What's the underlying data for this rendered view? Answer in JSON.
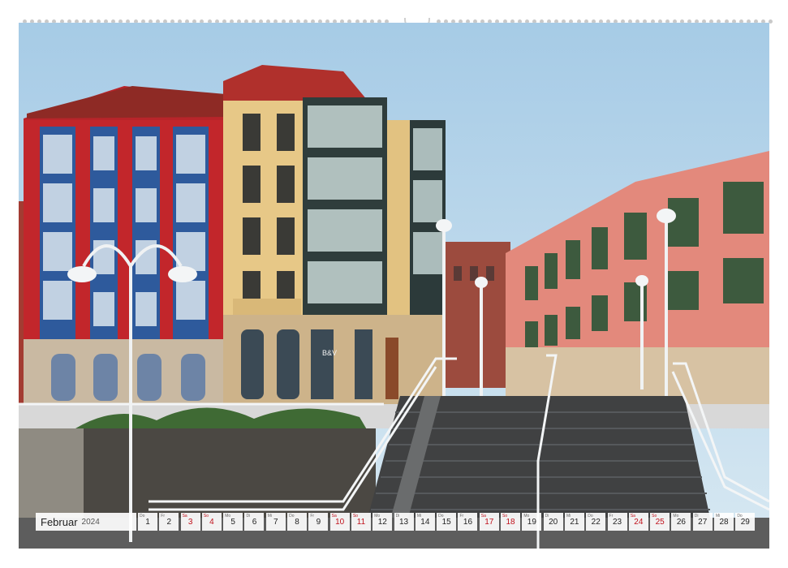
{
  "calendar": {
    "month": "Februar",
    "year": "2024",
    "days": [
      {
        "wd": "Do",
        "num": "1",
        "red": false
      },
      {
        "wd": "Fr",
        "num": "2",
        "red": false
      },
      {
        "wd": "Sa",
        "num": "3",
        "red": true
      },
      {
        "wd": "So",
        "num": "4",
        "red": true
      },
      {
        "wd": "Mo",
        "num": "5",
        "red": false
      },
      {
        "wd": "Di",
        "num": "6",
        "red": false
      },
      {
        "wd": "Mi",
        "num": "7",
        "red": false
      },
      {
        "wd": "Do",
        "num": "8",
        "red": false
      },
      {
        "wd": "Fr",
        "num": "9",
        "red": false
      },
      {
        "wd": "Sa",
        "num": "10",
        "red": true
      },
      {
        "wd": "So",
        "num": "11",
        "red": true
      },
      {
        "wd": "Mo",
        "num": "12",
        "red": false
      },
      {
        "wd": "Di",
        "num": "13",
        "red": false
      },
      {
        "wd": "Mi",
        "num": "14",
        "red": false
      },
      {
        "wd": "Do",
        "num": "15",
        "red": false
      },
      {
        "wd": "Fr",
        "num": "16",
        "red": false
      },
      {
        "wd": "Sa",
        "num": "17",
        "red": true
      },
      {
        "wd": "So",
        "num": "18",
        "red": true
      },
      {
        "wd": "Mo",
        "num": "19",
        "red": false
      },
      {
        "wd": "Di",
        "num": "20",
        "red": false
      },
      {
        "wd": "Mi",
        "num": "21",
        "red": false
      },
      {
        "wd": "Do",
        "num": "22",
        "red": false
      },
      {
        "wd": "Fr",
        "num": "23",
        "red": false
      },
      {
        "wd": "Sa",
        "num": "24",
        "red": true
      },
      {
        "wd": "So",
        "num": "25",
        "red": true
      },
      {
        "wd": "Mo",
        "num": "26",
        "red": false
      },
      {
        "wd": "Di",
        "num": "27",
        "red": false
      },
      {
        "wd": "Mi",
        "num": "28",
        "red": false
      },
      {
        "wd": "Do",
        "num": "29",
        "red": false
      }
    ]
  },
  "photo": {
    "shop_sign": "B&V",
    "icons": {
      "binding": "spiral-binding-icon",
      "hanger": "hanger-hole-icon"
    }
  },
  "colors": {
    "weekend": "#c0111b",
    "sky": "#b9d8ec"
  }
}
